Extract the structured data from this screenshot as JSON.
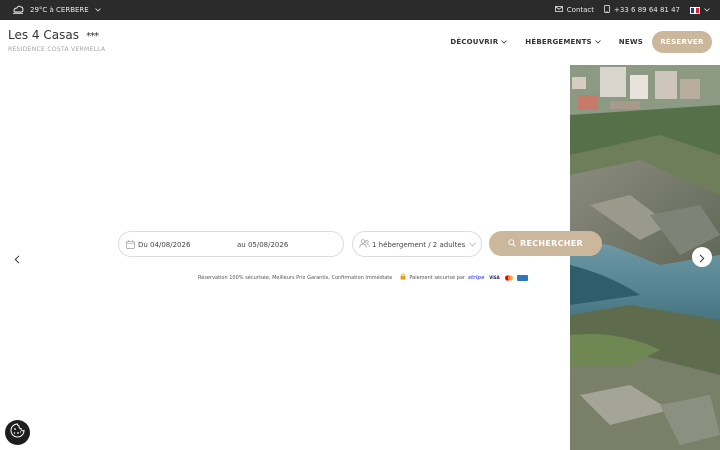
{
  "topbar": {
    "weather": "29°C à CERBERE",
    "contact": "Contact",
    "phone": "+33 6 89 64 81 47"
  },
  "header": {
    "brand_name": "Les 4 Casas",
    "brand_stars": "***",
    "brand_sub": "RESIDENCE COSTA VERMELLA",
    "nav": [
      {
        "label": "DÉCOUVRIR"
      },
      {
        "label": "HÉBERGEMENTS"
      },
      {
        "label": "NEWS"
      }
    ],
    "reserve_label": "RÉSERVER"
  },
  "search": {
    "date_from": "Du 04/08/2026",
    "date_to": "au 05/08/2026",
    "guests": "1 hébergement / 2 adultes",
    "button": "RECHERCHER"
  },
  "assurance": {
    "text": "Réservation 100% sécurisée, Meilleurs Prix Garantis, Confirmation Immédiate",
    "secure": "Paiement sécurisé par",
    "stripe": "stripe",
    "cards": [
      "VISA",
      "MC",
      "AMEX"
    ]
  },
  "colors": {
    "accent": "#cbb79c",
    "topbar": "#2b2b2b"
  }
}
